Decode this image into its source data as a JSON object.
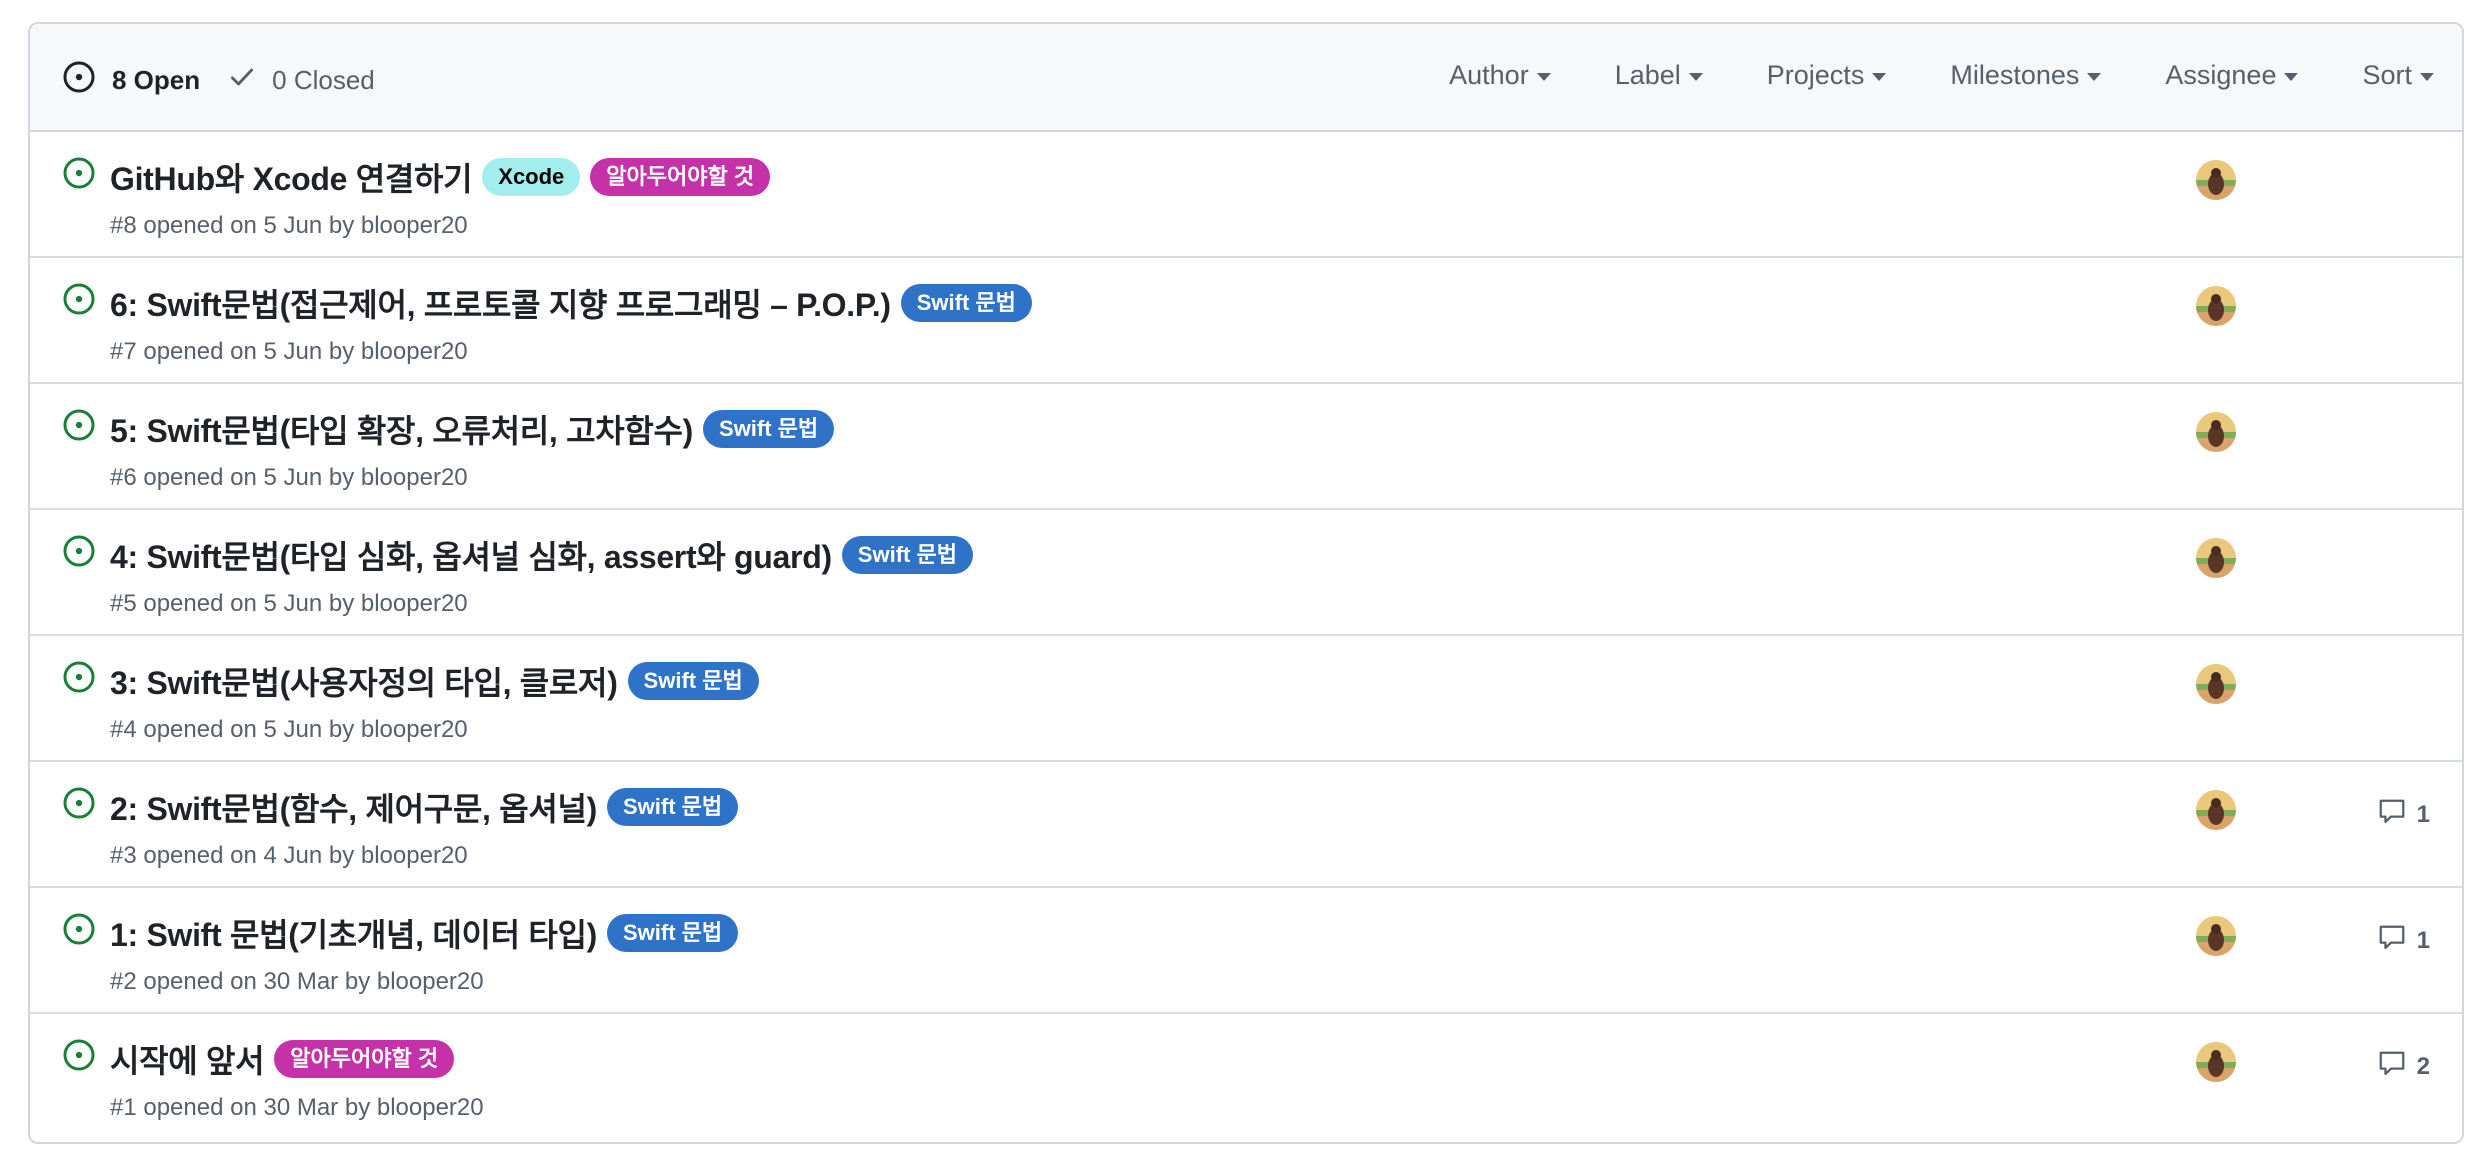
{
  "header": {
    "open_label": "8 Open",
    "closed_label": "0 Closed",
    "filters": [
      "Author",
      "Label",
      "Projects",
      "Milestones",
      "Assignee",
      "Sort"
    ]
  },
  "colors": {
    "open_icon": "#1a7f37",
    "label_xcode_bg": "#a2eeef",
    "label_xcode_fg": "#000000",
    "label_know_bg": "#c531a8",
    "label_know_fg": "#ffffff",
    "label_swift_bg": "#2f73c8",
    "label_swift_fg": "#ffffff"
  },
  "issues": [
    {
      "title": "GitHub와 Xcode 연결하기",
      "labels": [
        {
          "text": "Xcode",
          "kind": "xcode"
        },
        {
          "text": "알아두어야할 것",
          "kind": "know"
        }
      ],
      "meta": "#8 opened on 5 Jun by blooper20",
      "comments": ""
    },
    {
      "title": "6: Swift문법(접근제어, 프로토콜 지향 프로그래밍 – P.O.P.)",
      "labels": [
        {
          "text": "Swift 문법",
          "kind": "swift"
        }
      ],
      "meta": "#7 opened on 5 Jun by blooper20",
      "comments": ""
    },
    {
      "title": "5: Swift문법(타입 확장, 오류처리, 고차함수)",
      "labels": [
        {
          "text": "Swift 문법",
          "kind": "swift"
        }
      ],
      "meta": "#6 opened on 5 Jun by blooper20",
      "comments": ""
    },
    {
      "title": "4: Swift문법(타입 심화, 옵셔널 심화, assert와 guard)",
      "labels": [
        {
          "text": "Swift 문법",
          "kind": "swift"
        }
      ],
      "meta": "#5 opened on 5 Jun by blooper20",
      "comments": ""
    },
    {
      "title": "3: Swift문법(사용자정의 타입, 클로저)",
      "labels": [
        {
          "text": "Swift 문법",
          "kind": "swift"
        }
      ],
      "meta": "#4 opened on 5 Jun by blooper20",
      "comments": ""
    },
    {
      "title": "2: Swift문법(함수, 제어구문, 옵셔널)",
      "labels": [
        {
          "text": "Swift 문법",
          "kind": "swift"
        }
      ],
      "meta": "#3 opened on 4 Jun by blooper20",
      "comments": "1"
    },
    {
      "title": "1: Swift 문법(기초개념, 데이터 타입)",
      "labels": [
        {
          "text": "Swift 문법",
          "kind": "swift"
        }
      ],
      "meta": "#2 opened on 30 Mar by blooper20",
      "comments": "1"
    },
    {
      "title": "시작에 앞서",
      "labels": [
        {
          "text": "알아두어야할 것",
          "kind": "know"
        }
      ],
      "meta": "#1 opened on 30 Mar by blooper20",
      "comments": "2"
    }
  ]
}
